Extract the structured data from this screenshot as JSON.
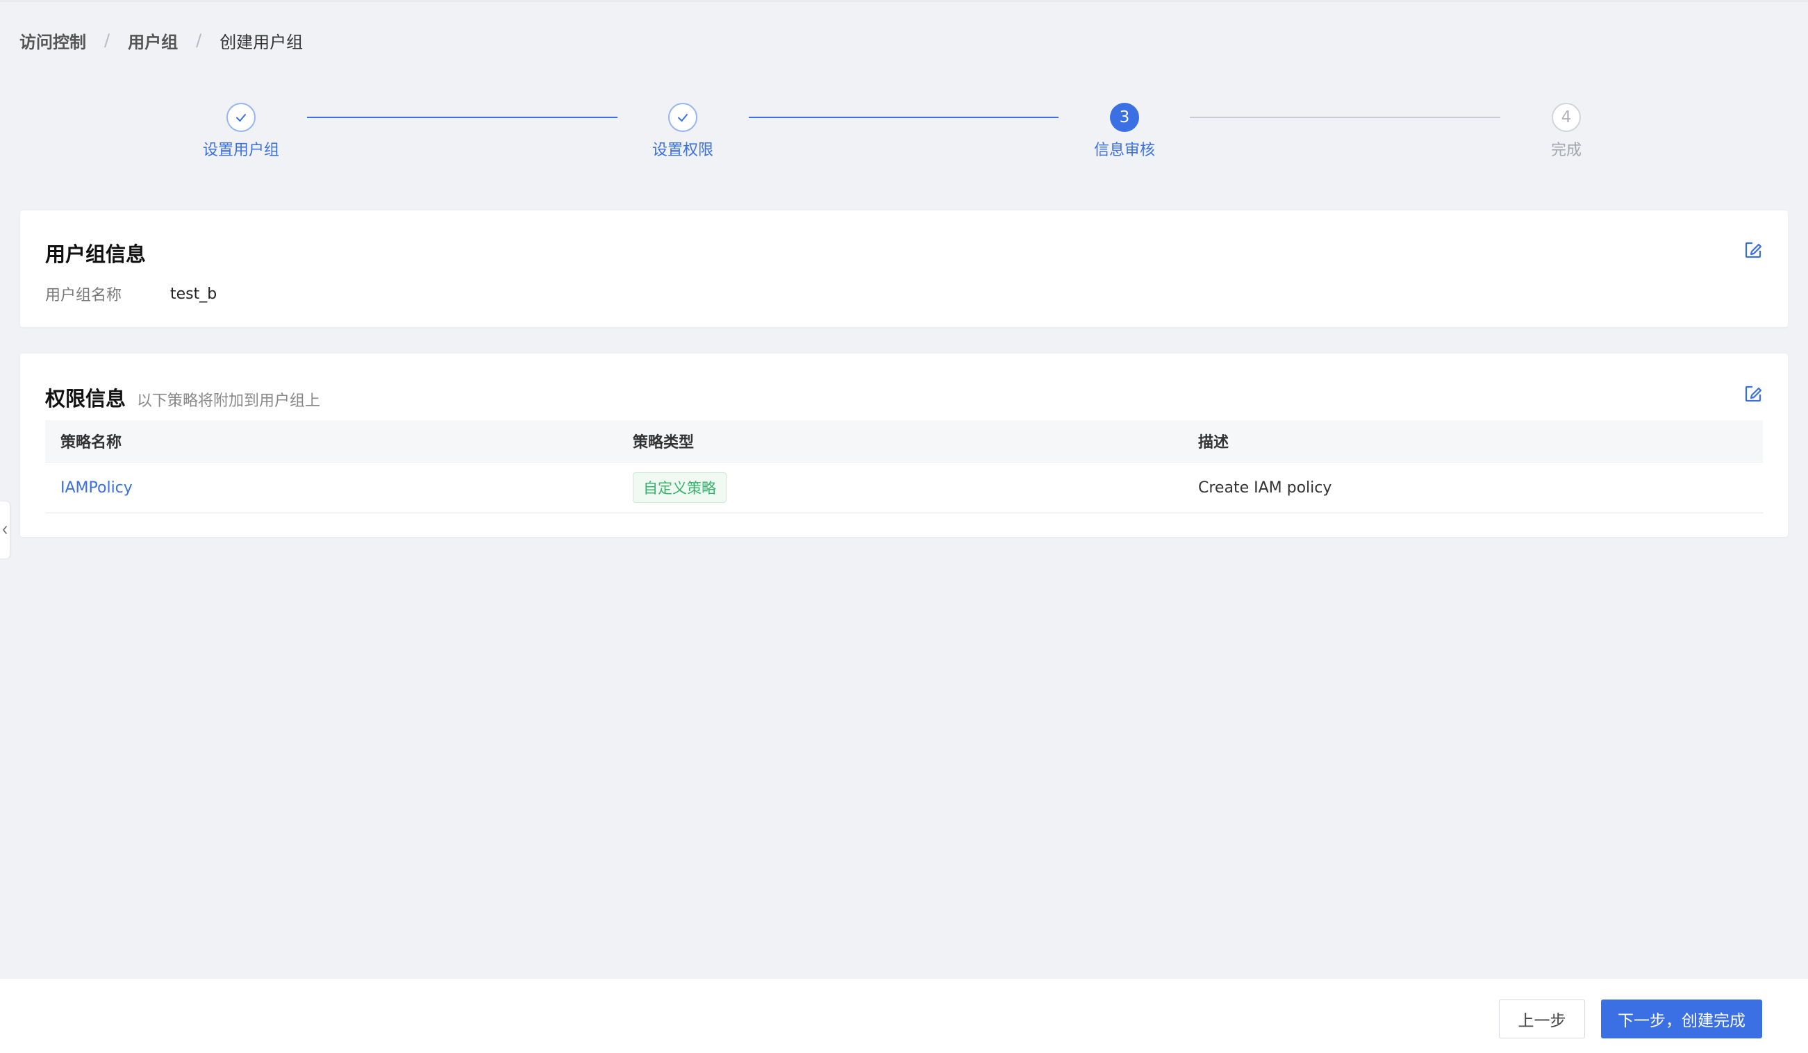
{
  "breadcrumb": {
    "items": [
      "访问控制",
      "用户组",
      "创建用户组"
    ],
    "separator": "/"
  },
  "steps": [
    {
      "label": "设置用户组",
      "status": "done",
      "number": "1"
    },
    {
      "label": "设置权限",
      "status": "done",
      "number": "2"
    },
    {
      "label": "信息审核",
      "status": "active",
      "number": "3"
    },
    {
      "label": "完成",
      "status": "todo",
      "number": "4"
    }
  ],
  "group_info": {
    "title": "用户组信息",
    "fields": [
      {
        "label": "用户组名称",
        "value": "test_b"
      }
    ],
    "edit_icon": "edit-icon"
  },
  "permission_info": {
    "title": "权限信息",
    "subtitle": "以下策略将附加到用户组上",
    "edit_icon": "edit-icon",
    "columns": [
      "策略名称",
      "策略类型",
      "描述"
    ],
    "rows": [
      {
        "name": "IAMPolicy",
        "type": "自定义策略",
        "description": "Create IAM policy"
      }
    ]
  },
  "footer": {
    "prev_label": "上一步",
    "next_label": "下一步，创建完成"
  },
  "colors": {
    "primary": "#3b6fe4",
    "tag_green": "#34b46a",
    "background": "#f0f2f5"
  }
}
